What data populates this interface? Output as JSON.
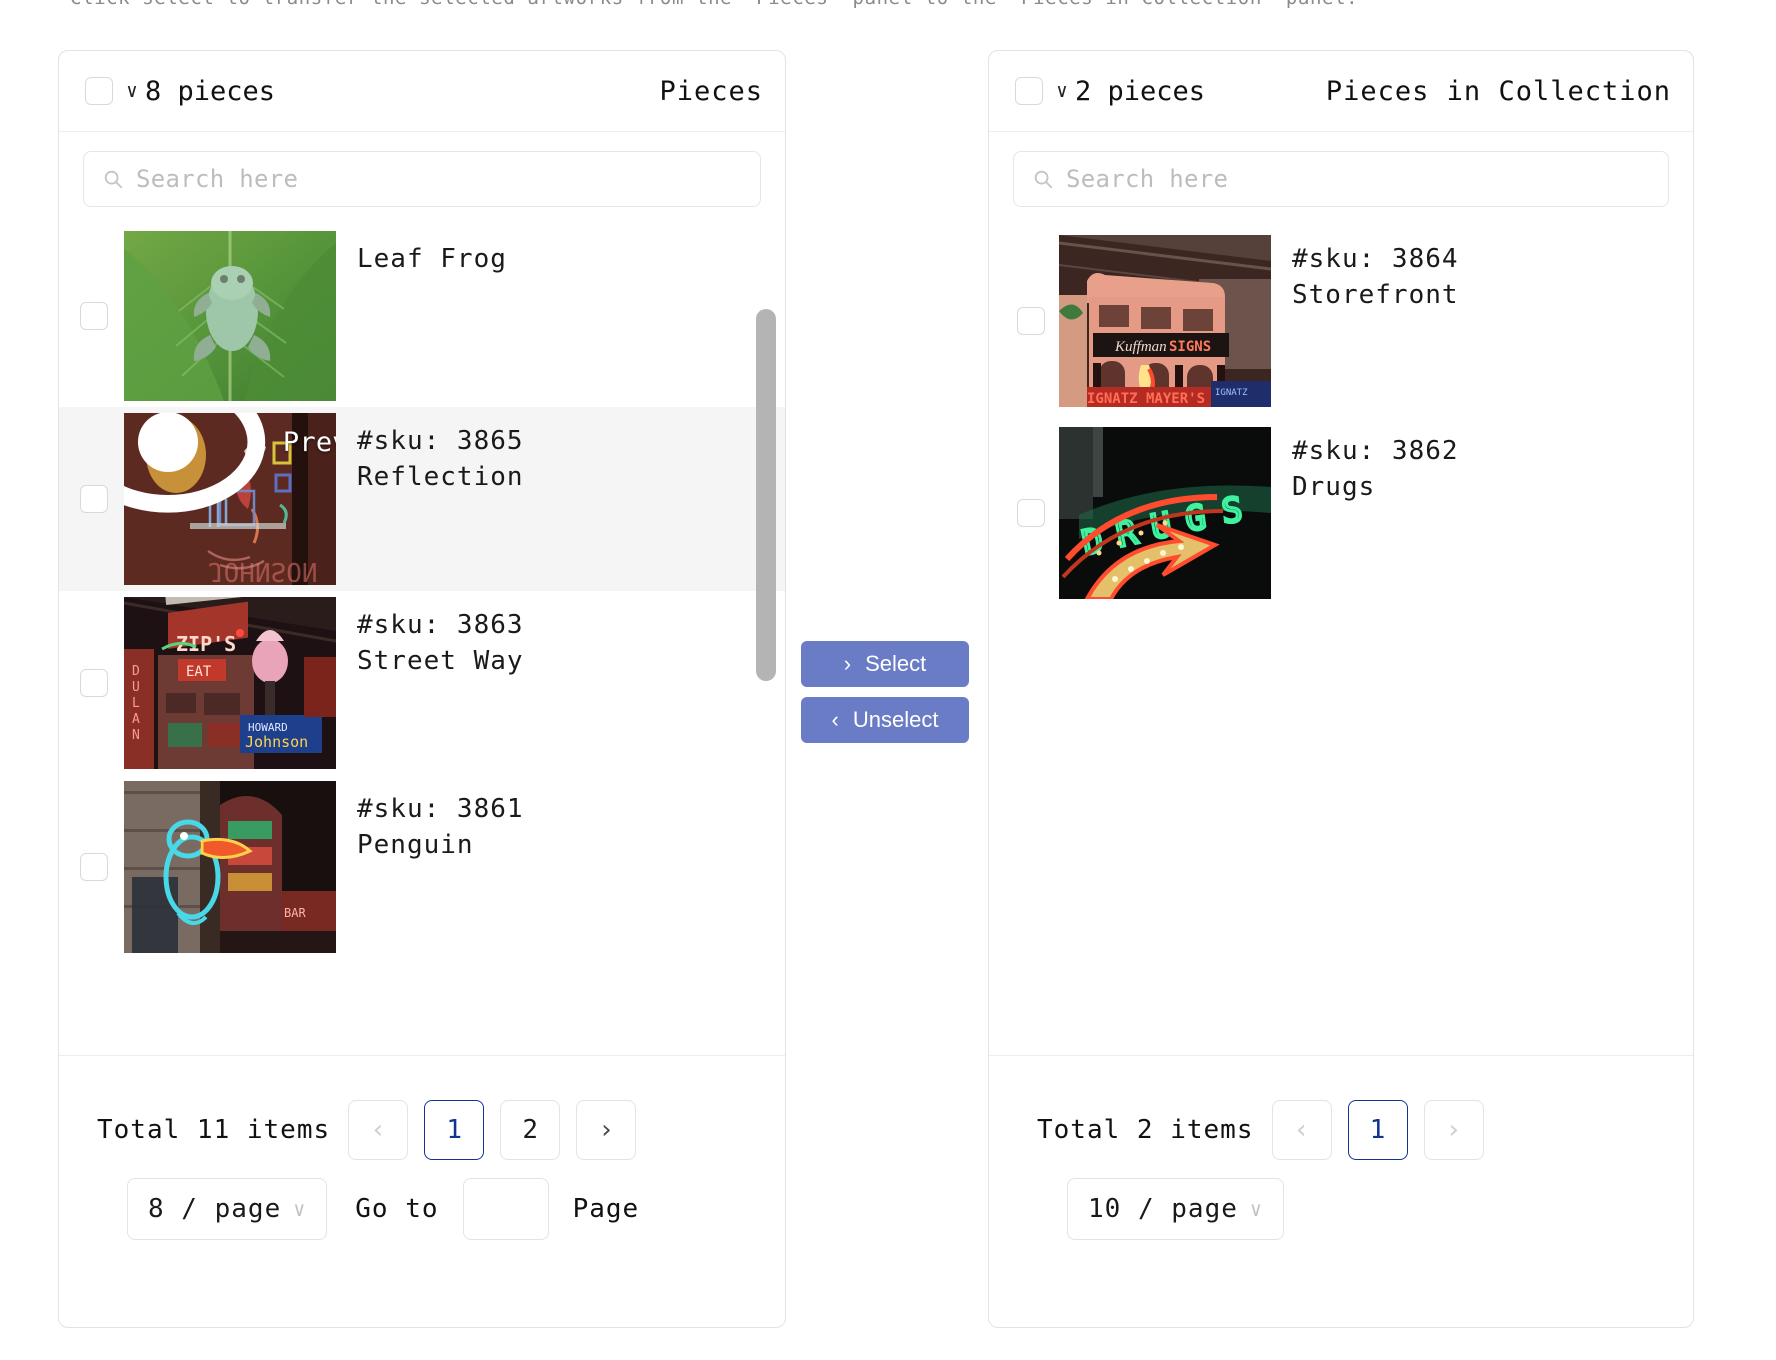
{
  "instruction": "Click select to transfer the selected artworks from the 'Pieces' panel to the 'Pieces in Collection' panel.",
  "left_panel": {
    "title": "Pieces",
    "count_label": "8 pieces",
    "chevron": "∨",
    "search_placeholder": "Search here",
    "items": [
      {
        "sku": "",
        "name": "Leaf Frog",
        "preview_label": "",
        "selected": false,
        "image": "leaf-frog"
      },
      {
        "sku": "#sku: 3865",
        "name": "Reflection",
        "preview_label": "Preview",
        "selected": true,
        "image": "reflection-neon"
      },
      {
        "sku": "#sku: 3863",
        "name": "Street Way",
        "preview_label": "",
        "selected": false,
        "image": "street-way-neon"
      },
      {
        "sku": "#sku: 3861",
        "name": "Penguin",
        "preview_label": "",
        "selected": false,
        "image": "penguin-neon"
      }
    ],
    "footer": {
      "total": "Total 11 items",
      "prev": "‹",
      "next": "›",
      "pages": [
        "1",
        "2"
      ],
      "current_page": "1",
      "per_page": "8 / page",
      "goto_label": "Go to",
      "goto_value": "",
      "page_label": "Page"
    }
  },
  "right_panel": {
    "title": "Pieces in Collection",
    "count_label": "2 pieces",
    "chevron": "∨",
    "search_placeholder": "Search here",
    "items": [
      {
        "sku": "#sku: 3864",
        "name": "Storefront",
        "selected": false,
        "image": "storefront-neon"
      },
      {
        "sku": "#sku: 3862",
        "name": "Drugs",
        "selected": false,
        "image": "drugs-neon"
      }
    ],
    "footer": {
      "total": "Total 2 items",
      "prev": "‹",
      "next": "›",
      "pages": [
        "1"
      ],
      "current_page": "1",
      "per_page": "10 / page"
    }
  },
  "transfer": {
    "select_label": "Select",
    "select_arrow": "›",
    "unselect_label": "Unselect",
    "unselect_arrow": "‹"
  },
  "colors": {
    "button": "#6a7cc6",
    "current_page": "#12338f",
    "row_active": "#f5f5f5",
    "border": "#e3e3e3"
  }
}
